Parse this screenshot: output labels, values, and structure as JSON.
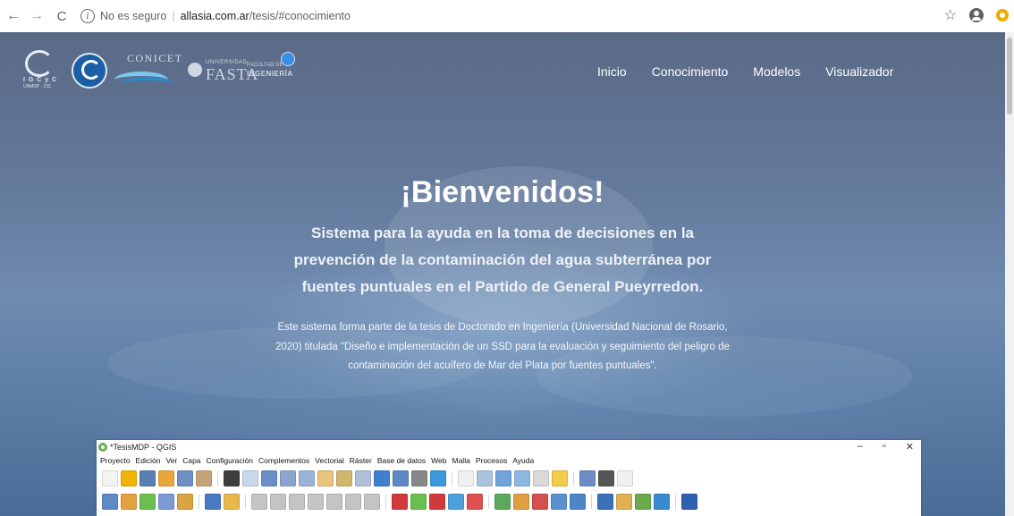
{
  "browser": {
    "security_label": "No es seguro",
    "url_host": "allasia.com.ar",
    "url_path": "/tesis/#conocimiento",
    "icons": [
      "back-arrow-icon",
      "forward-arrow-icon",
      "reload-icon",
      "info-icon",
      "star-icon",
      "profile-icon",
      "extension-icon"
    ]
  },
  "site": {
    "logos": {
      "iccyc_line1": "I G C y C",
      "iccyc_line2": "UNMDP · CIC",
      "conicet": "CONICET",
      "fasta_small": "UNIVERSIDAD",
      "fasta": "FASTA",
      "faculty_small": "FACULTAD DE",
      "faculty": "INGENIERÍA"
    },
    "nav": [
      "Inicio",
      "Conocimiento",
      "Modelos",
      "Visualizador"
    ],
    "title": "¡Bienvenidos!",
    "subtitle": "Sistema para la ayuda en la toma de decisiones en la prevención de la contaminación del agua subterránea por fuentes puntuales en el Partido de General Pueyrredon.",
    "description": "Este sistema forma parte de la tesis de Doctorado en Ingeniería (Universidad Nacional de Rosario, 2020) titulada \"Diseño e implementación de un SSD para la evaluación y seguimiento del peligro de contaminación del acuífero de Mar del Plata por fuentes puntuales\"."
  },
  "qgis": {
    "title": "*TesisMDP - QGIS",
    "window_buttons": [
      "–",
      "▫",
      "✕"
    ],
    "menu": [
      "Proyecto",
      "Edición",
      "Ver",
      "Capa",
      "Configuración",
      "Complementos",
      "Vectorial",
      "Ráster",
      "Base de datos",
      "Web",
      "Malla",
      "Procesos",
      "Ayuda"
    ],
    "toolbar1_colors": [
      "#f4f4f4",
      "#f2b400",
      "#5a7fb3",
      "#e9a63a",
      "#6d8fc4",
      "#c6a27a",
      "#3d3d3d",
      "#c8d7ea",
      "#6a8ec8",
      "#8aa5d0",
      "#9bb4d6",
      "#e7c37b",
      "#d0b56b",
      "#aebfd9",
      "#3f7fd0",
      "#5e88c5",
      "#888888",
      "#3a9ad9",
      "#f0f0f0",
      "#aac2e0",
      "#6fa3da",
      "#8cb7e2",
      "#d9d9d9",
      "#f2cc4a",
      "#6d8bc4",
      "#555555",
      "#f0f0f0"
    ],
    "toolbar2_colors": [
      "#5d8bc5",
      "#e2a23e",
      "#6bbf4e",
      "#7a9bd4",
      "#d9a441",
      "#4a79c4",
      "#e8b84a",
      "#c4c4c4",
      "#c4c4c4",
      "#c4c4c4",
      "#c4c4c4",
      "#c4c4c4",
      "#c4c4c4",
      "#c4c4c4",
      "#d13a3a",
      "#6bbf4e",
      "#d13a3a",
      "#4aa0d9",
      "#e05050",
      "#5ca85c",
      "#e0a040",
      "#d65050",
      "#5a92d0",
      "#4a86c8",
      "#3a70b8",
      "#e0b050",
      "#6aaa4a",
      "#3a8ad0",
      "#3060b0"
    ]
  }
}
